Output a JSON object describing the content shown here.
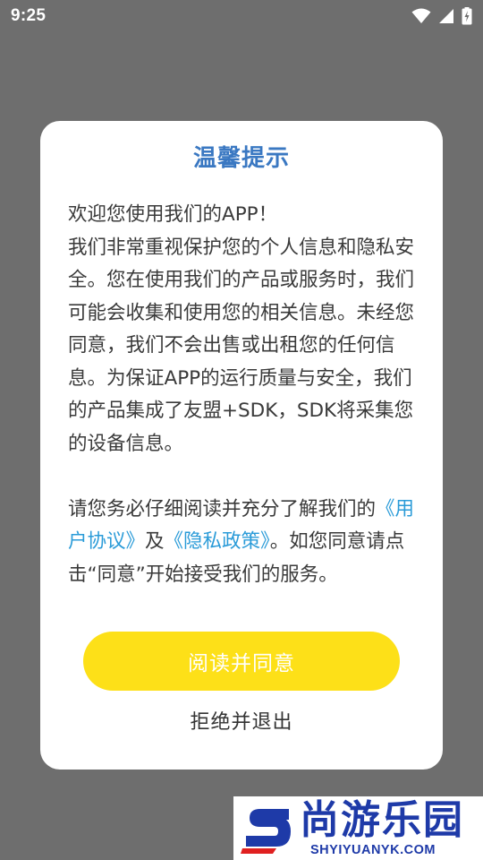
{
  "status_bar": {
    "time": "9:25",
    "icons": [
      "wifi-icon",
      "cellular-signal-icon",
      "battery-charging-icon"
    ]
  },
  "dialog": {
    "title": "温馨提示",
    "paragraph1_line1": "欢迎您使用我们的APP！",
    "paragraph1_rest": "我们非常重视保护您的个人信息和隐私安全。您在使用我们的产品或服务时，我们可能会收集和使用您的相关信息。未经您同意，我们不会出售或出租您的任何信息。为保证APP的运行质量与安全，我们的产品集成了友盟+SDK，SDK将采集您的设备信息。",
    "paragraph2_prefix": "请您务必仔细阅读并充分了解我们的",
    "user_agreement_link": "《用户协议》",
    "and_text": "及",
    "privacy_policy_link": "《隐私政策》",
    "paragraph2_suffix": "。如您同意请点击“同意”开始接受我们的服务。",
    "agree_button": "阅读并同意",
    "reject_button": "拒绝并退出"
  },
  "watermark": {
    "brand": "尚游乐园",
    "url": "SHYIYUANYK.COM"
  },
  "colors": {
    "overlay": "#6e6e6e",
    "title_blue": "#3a78c2",
    "link_blue": "#2a9bd8",
    "agree_yellow": "#fde018",
    "brand_blue": "#1e3aa8",
    "brand_red": "#e02020"
  }
}
